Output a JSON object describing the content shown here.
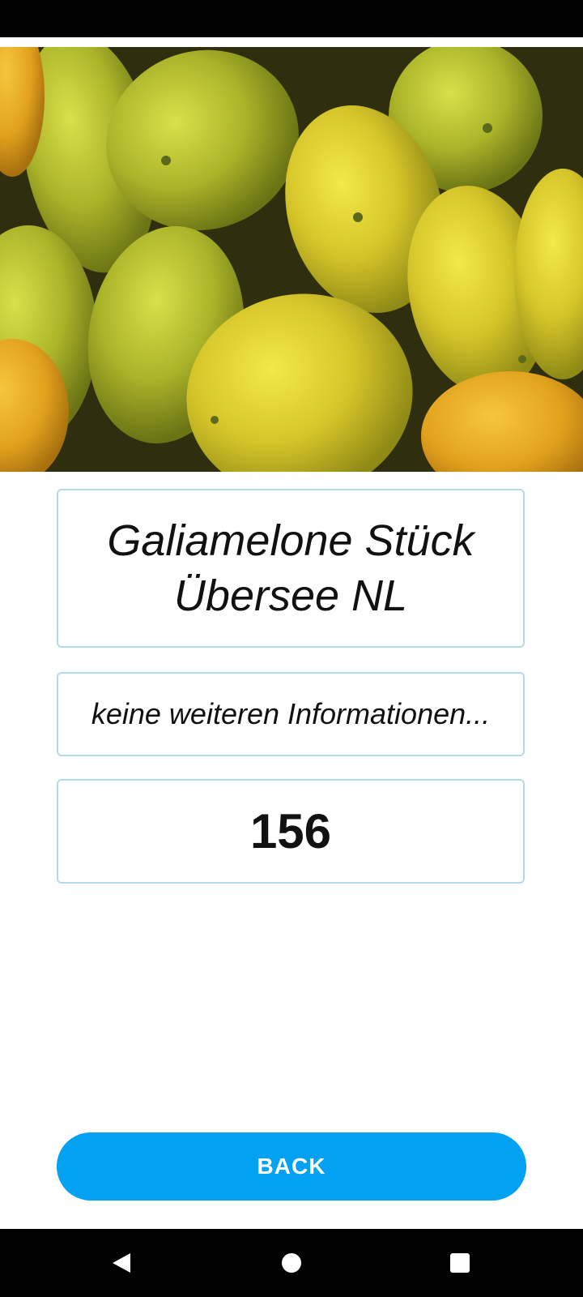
{
  "product": {
    "name_line1": "Galiamelone Stück",
    "name_line2": "Übersee NL",
    "info": "keine weiteren Informationen...",
    "number": "156"
  },
  "actions": {
    "back_label": "BACK"
  },
  "hero_image": {
    "subject": "galia-melons-photo"
  },
  "navigation": {
    "icons": [
      "back-triangle-icon",
      "home-circle-icon",
      "recents-square-icon"
    ]
  },
  "colors": {
    "accent": "#03a1f2",
    "card_border": "#b2dbe3",
    "system_bars": "#000000"
  }
}
